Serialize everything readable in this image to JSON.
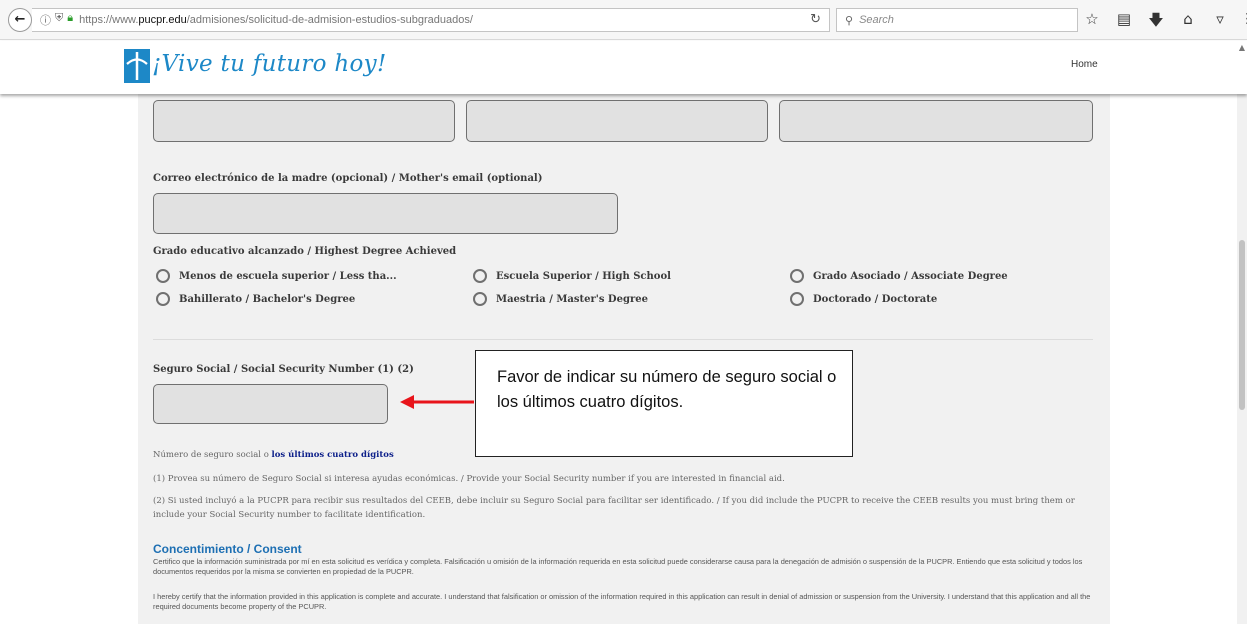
{
  "browser": {
    "back_icon": "back-arrow-icon",
    "url_prefix": "https://www.",
    "url_domain": "pucpr.edu",
    "url_path": "/admisiones/solicitud-de-admision-estudios-subgraduados/",
    "search_placeholder": "Search",
    "toolbar_icons": [
      "bookmark-star-icon",
      "library-icon",
      "download-icon",
      "home-icon",
      "pocket-icon",
      "menu-icon"
    ]
  },
  "header": {
    "logo_text": "¡Vive tu futuro hoy!",
    "nav_home": "Home",
    "brand_color": "#1d88c7"
  },
  "form": {
    "mother_email_label": "Correo electrónico de la madre (opcional) / Mother's email (optional)",
    "mother_email_value": "",
    "degree_label": "Grado educativo alcanzado / Highest Degree Achieved",
    "degree_options": [
      "Menos de escuela superior / Less tha...",
      "Escuela Superior / High School",
      "Grado Asociado / Associate Degree",
      "Bahillerato / Bachelor's Degree",
      "Maestria / Master's Degree",
      "Doctorado / Doctorate"
    ],
    "ssn_label": "Seguro Social / Social Security Number (1) (2)",
    "ssn_value": "",
    "ssn_hint_prefix": "Número de seguro social o ",
    "ssn_hint_link": "los últimos cuatro dígitos",
    "note_1": "(1) Provea su número de Seguro Social si interesa ayudas económicas. / Provide your Social Security number if you are interested in financial aid.",
    "note_2": "(2) Si usted incluyó a la PUCPR para recibir sus resultados del CEEB, debe incluir su Seguro Social para facilitar ser identificado. / If you did include the PUCPR to receive the CEEB results you must bring them or include your Social Security number to facilitate identification."
  },
  "consent": {
    "title": "Concentimiento / Consent",
    "text_es": "Certifico que la información suministrada por mí en esta solicitud es verídica y completa. Falsificación u omisión de la información requerida en esta solicitud puede considerarse causa para la denegación de admisión o suspensión de la PUCPR. Entiendo que esta solicitud y todos los documentos requeridos por la misma se convierten en propiedad de la PUCPR.",
    "text_en": "I hereby certify that the information provided in this application is complete and accurate. I understand that falsification or omission of the information required in this application can result in denial of admission or suspension from the University. I understand that this application and all the required documents become property of the PCUPR."
  },
  "callout": {
    "text": "Favor de indicar su número de seguro social o los últimos cuatro dígitos.",
    "arrow_color": "#e8141b"
  }
}
